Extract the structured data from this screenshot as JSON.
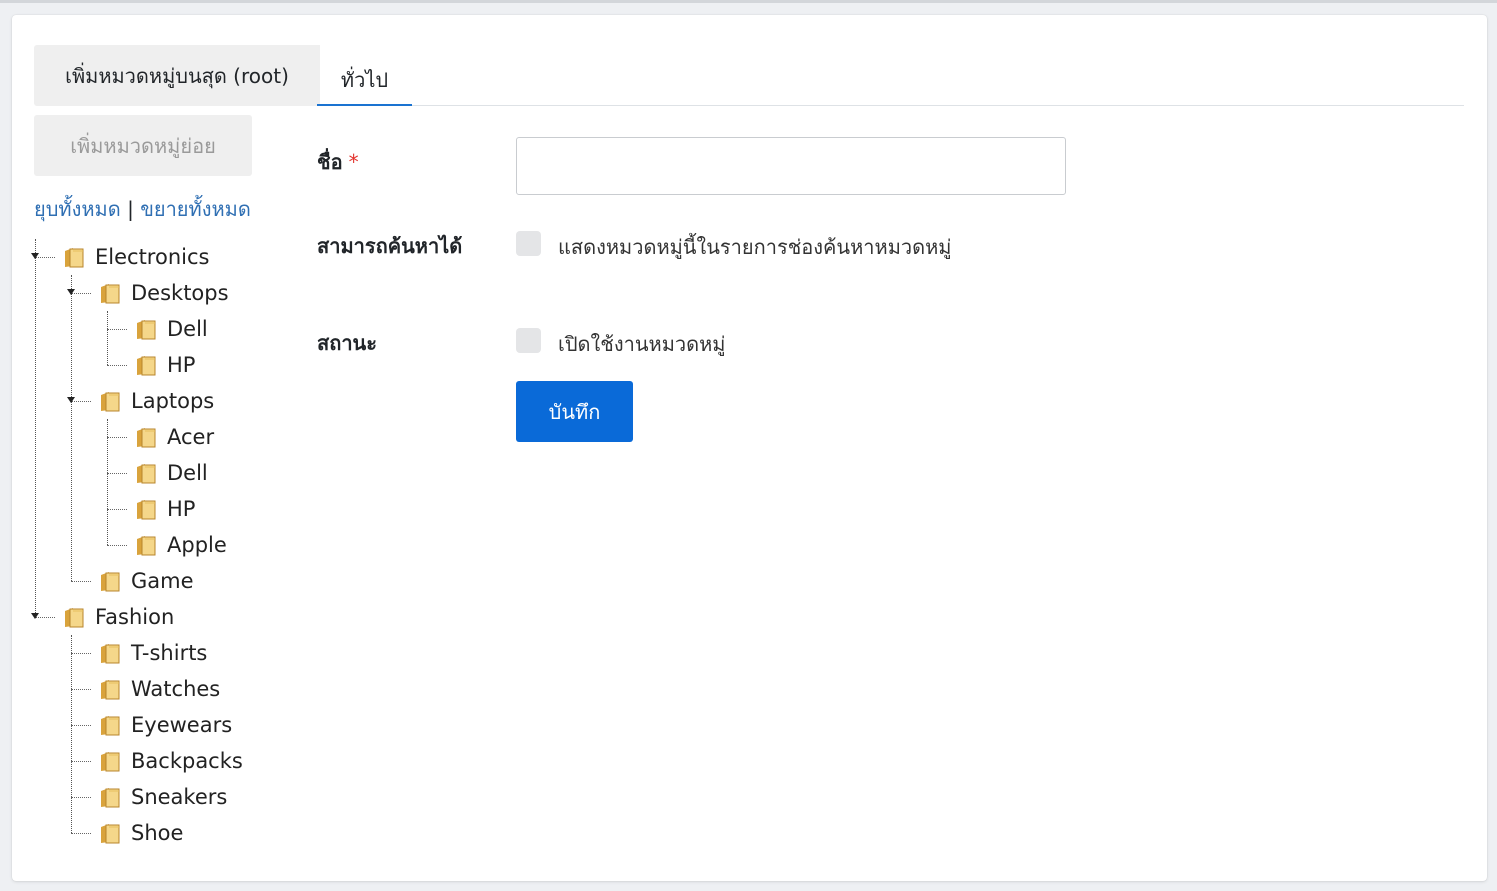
{
  "sidebar": {
    "add_root_label": "เพิ่มหมวดหมู่บนสุด (root)",
    "add_sub_label": "เพิ่มหมวดหมู่ย่อย",
    "collapse_all": "ยุบทั้งหมด",
    "separator": "|",
    "expand_all": "ขยายทั้งหมด"
  },
  "tree": {
    "electronics": "Electronics",
    "desktops": "Desktops",
    "desktops_dell": "Dell",
    "desktops_hp": "HP",
    "laptops": "Laptops",
    "laptops_acer": "Acer",
    "laptops_dell": "Dell",
    "laptops_hp": "HP",
    "laptops_apple": "Apple",
    "game": "Game",
    "fashion": "Fashion",
    "tshirts": "T-shirts",
    "watches": "Watches",
    "eyewears": "Eyewears",
    "backpacks": "Backpacks",
    "sneakers": "Sneakers",
    "shoe": "Shoe"
  },
  "tabs": {
    "general": "ทั่วไป"
  },
  "form": {
    "name_label": "ชื่อ",
    "required_mark": "*",
    "name_value": "",
    "searchable_label": "สามารถค้นหาได้",
    "searchable_checkbox_label": "แสดงหมวดหมู่นี้ในรายการช่องค้นหาหมวดหมู่",
    "status_label": "สถานะ",
    "status_checkbox_label": "เปิดใช้งานหมวดหมู่",
    "save_label": "บันทึก"
  },
  "colors": {
    "accent": "#0a6ad8",
    "link": "#2f6fb3",
    "required": "#e3342f"
  }
}
